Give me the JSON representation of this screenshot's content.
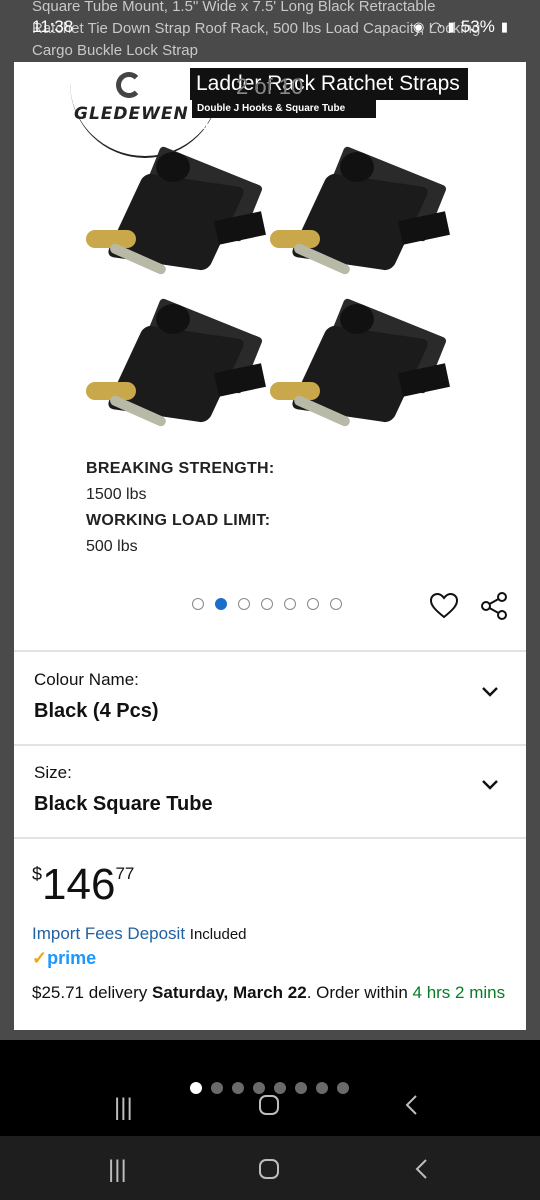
{
  "backdrop": {
    "title_line1": "Square Tube Mount, 1.5\" Wide x 7.5' Long Black Retractable",
    "title_line2": "Ratchet Tie Down Strap Roof Rack, 500 lbs Load Capacity, Locking",
    "title_line3": "Cargo Buckle Lock Strap"
  },
  "status_bar": {
    "time": "11:38",
    "battery": "53%"
  },
  "gallery": {
    "brand_name": "GLEDEWEN",
    "banner_title": "Ladder Rack Ratchet Straps",
    "banner_subtitle": "Double J Hooks & Square Tube Mount",
    "counter": "2 of 10",
    "breaking_label": "BREAKING STRENGTH:",
    "breaking_value": "1500 lbs",
    "wll_label": "WORKING LOAD LIMIT:",
    "wll_value": "500 lbs",
    "dot_count": 7,
    "active_dot": 2
  },
  "options": {
    "colour_label": "Colour Name:",
    "colour_value": "Black (4 Pcs)",
    "size_label": "Size:",
    "size_value": "Black Square Tube"
  },
  "price": {
    "currency": "$",
    "whole": "146",
    "fraction": "77"
  },
  "fees": {
    "link": "Import Fees Deposit",
    "status": "Included"
  },
  "prime": {
    "check": "✓",
    "label": "prime"
  },
  "delivery": {
    "amount": "$25.71 delivery",
    "date": "Saturday, March 22",
    "order_within": ". Order within",
    "countdown": "4 hrs 2 mins"
  },
  "image_dots": {
    "count": 8,
    "active": 1
  },
  "colors": {
    "accent_blue": "#1b6fc9",
    "link_blue": "#2162a1",
    "prime_blue": "#1a98ff",
    "countdown_green": "#067d25"
  }
}
